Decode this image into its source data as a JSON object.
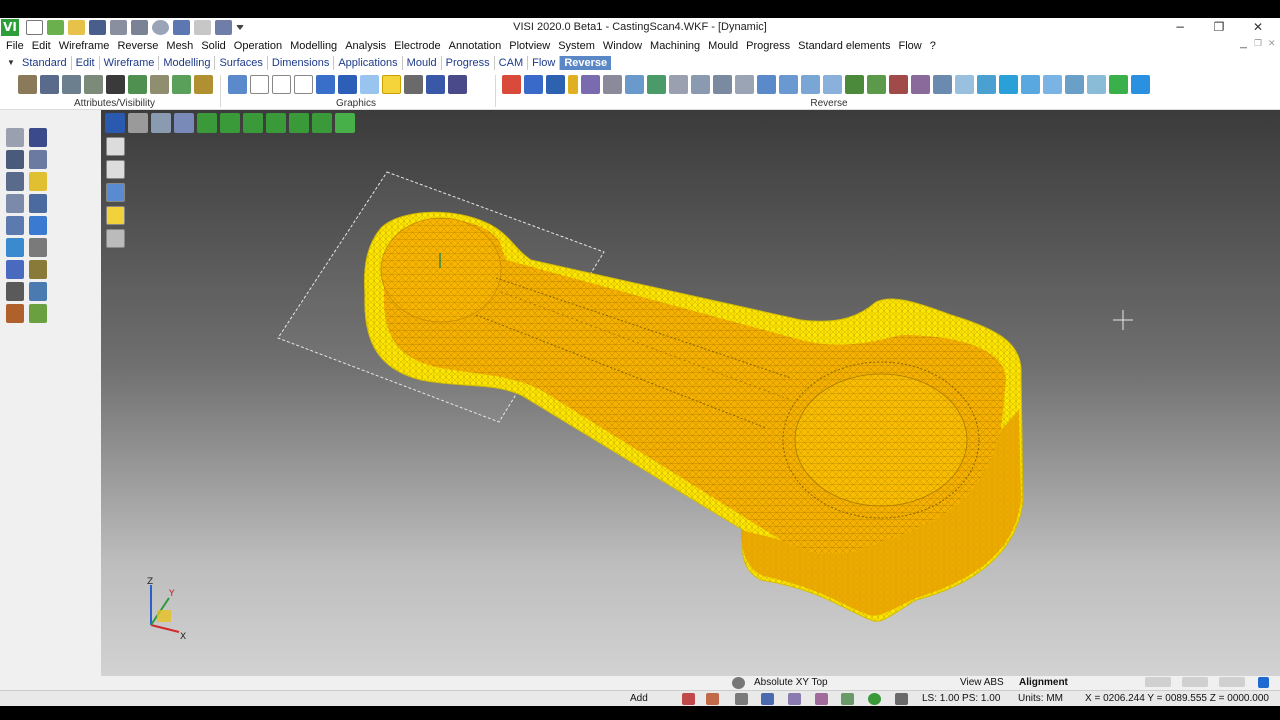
{
  "window": {
    "app_icon": "VI",
    "title": "VISI 2020.0 Beta1 - CastingScan4.WKF - [Dynamic]",
    "controls": {
      "minimize": "−",
      "restore": "❐",
      "close": "✕"
    }
  },
  "quick_access": [
    "new-icon",
    "open-icon",
    "open-folder-icon",
    "save-icon",
    "print-setup-icon",
    "print-icon",
    "zoom-icon",
    "undo-icon",
    "redo-icon",
    "redo-history-icon",
    "customize-dropdown-icon"
  ],
  "menu": [
    "File",
    "Edit",
    "Wireframe",
    "Reverse",
    "Mesh",
    "Solid",
    "Operation",
    "Modelling",
    "Analysis",
    "Electrode",
    "Annotation",
    "Plotview",
    "System",
    "Window",
    "Machining",
    "Mould",
    "Progress",
    "Standard elements",
    "Flow",
    "?"
  ],
  "ribbon_tabs": [
    "Standard",
    "Edit",
    "Wireframe",
    "Modelling",
    "Surfaces",
    "Dimensions",
    "Applications",
    "Mould",
    "Progress",
    "CAM",
    "Flow",
    "Reverse"
  ],
  "active_tab": "Reverse",
  "ribbon_groups": [
    {
      "label": "Attributes/Visibility",
      "icon_count": 9
    },
    {
      "label": "Graphics",
      "icon_count": 11
    },
    {
      "label": "Reverse",
      "icon_count": 30
    }
  ],
  "statusbar": {
    "view_name": "Absolute XY Top",
    "view_abs": "View ABS",
    "alignment": "Alignment",
    "mode": "Add",
    "ls_ps": "LS: 1.00 PS: 1.00",
    "units": "Units: MM",
    "coords": "X = 0206.244 Y = 0089.555 Z = 0000.000"
  },
  "axis_triad": {
    "x": "X",
    "y": "Y",
    "z": "Z"
  },
  "colors": {
    "mesh_yellow": "#ffe600",
    "mesh_orange": "#f2a600",
    "active_tab": "#5a87c5",
    "tab_text": "#1d3a8a"
  }
}
